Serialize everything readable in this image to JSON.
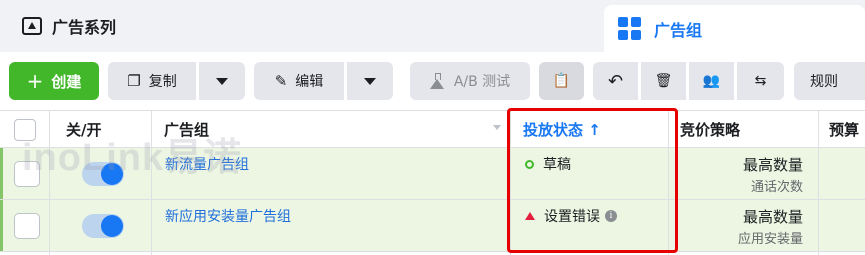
{
  "tabs": {
    "campaign_label": "广告系列",
    "adset_label": "广告组"
  },
  "toolbar": {
    "create_label": "创建",
    "copy_label": "复制",
    "edit_label": "编辑",
    "ab_test_label": "A/B 测试",
    "rules_label": "规则"
  },
  "table": {
    "headers": {
      "on_off": "关/开",
      "name": "广告组",
      "status": "投放状态 ↑",
      "bid_strategy": "竞价策略",
      "budget": "预算"
    },
    "rows": [
      {
        "name": "新流量广告组",
        "status": "草稿",
        "bid": "最高数量",
        "bid_sub": "通话次数"
      },
      {
        "name": "新应用安装量广告组",
        "status": "设置错误",
        "bid": "最高数量",
        "bid_sub": "应用安装量"
      }
    ]
  },
  "watermark": "inoLink易诺",
  "colors": {
    "accent": "#1877f2",
    "create": "#42b72a",
    "row_highlight": "#ecf6e3",
    "draft_status": "#42b72a",
    "error_status": "#e41e3f",
    "annotation": "#e60000"
  }
}
